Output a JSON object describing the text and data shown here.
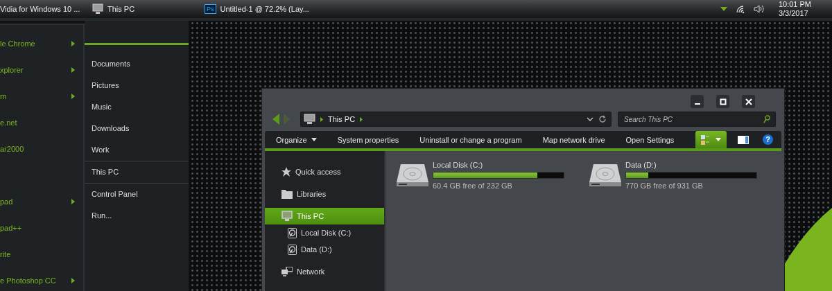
{
  "taskbar": {
    "items": [
      {
        "label": "Vidia for Windows 10 ...",
        "kind": "none"
      },
      {
        "label": "This PC",
        "kind": "monitor"
      },
      {
        "label": "Untitled-1 @ 72.2% (Lay...",
        "kind": "photoshop",
        "badge": "Ps"
      }
    ],
    "clock": {
      "time": "10:01 PM",
      "date": "3/3/2017"
    }
  },
  "start_menu": {
    "programs": [
      {
        "label": "le Chrome",
        "submenu": true
      },
      {
        "label": "xplorer",
        "submenu": true
      },
      {
        "label": "m",
        "submenu": true
      },
      {
        "label": "e.net",
        "submenu": false
      },
      {
        "label": "ar2000",
        "submenu": false
      },
      {
        "label": "pad",
        "submenu": true
      },
      {
        "label": "pad++",
        "submenu": false
      },
      {
        "label": "rite",
        "submenu": false
      },
      {
        "label": "e Photoshop CC",
        "submenu": true
      }
    ],
    "places": [
      {
        "label": "Documents",
        "separator_before": false
      },
      {
        "label": "Pictures",
        "separator_before": false
      },
      {
        "label": "Music",
        "separator_before": false
      },
      {
        "label": "Downloads",
        "separator_before": false
      },
      {
        "label": "Work",
        "separator_before": false
      },
      {
        "label": "This PC",
        "separator_before": true
      },
      {
        "label": "Control Panel",
        "separator_before": true
      },
      {
        "label": "Run...",
        "separator_before": false
      }
    ]
  },
  "explorer": {
    "address": {
      "segments": [
        "This PC"
      ]
    },
    "search": {
      "placeholder": "Search This PC"
    },
    "help_glyph": "?",
    "commands": [
      {
        "label": "Organize",
        "dropdown": true
      },
      {
        "label": "System properties",
        "dropdown": false
      },
      {
        "label": "Uninstall or change a program",
        "dropdown": false
      },
      {
        "label": "Map network drive",
        "dropdown": false
      },
      {
        "label": "Open Settings",
        "dropdown": false
      }
    ],
    "nav": [
      {
        "label": "Quick access",
        "kind": "star",
        "selected": false
      },
      {
        "label": "Libraries",
        "kind": "folder",
        "selected": false
      },
      {
        "label": "This PC",
        "kind": "monitor",
        "selected": true,
        "children": [
          {
            "label": "Local Disk (C:)",
            "kind": "disk",
            "selected": false
          },
          {
            "label": "Data (D:)",
            "kind": "disk",
            "selected": false
          }
        ]
      },
      {
        "label": "Network",
        "kind": "network",
        "selected": false
      }
    ],
    "drives": [
      {
        "name": "Local Disk (C:)",
        "level": 0.8,
        "free_text": "60.4 GB free of 232 GB"
      },
      {
        "name": "Data (D:)",
        "level": 0.17,
        "free_text": "770 GB free of 931 GB"
      }
    ]
  }
}
